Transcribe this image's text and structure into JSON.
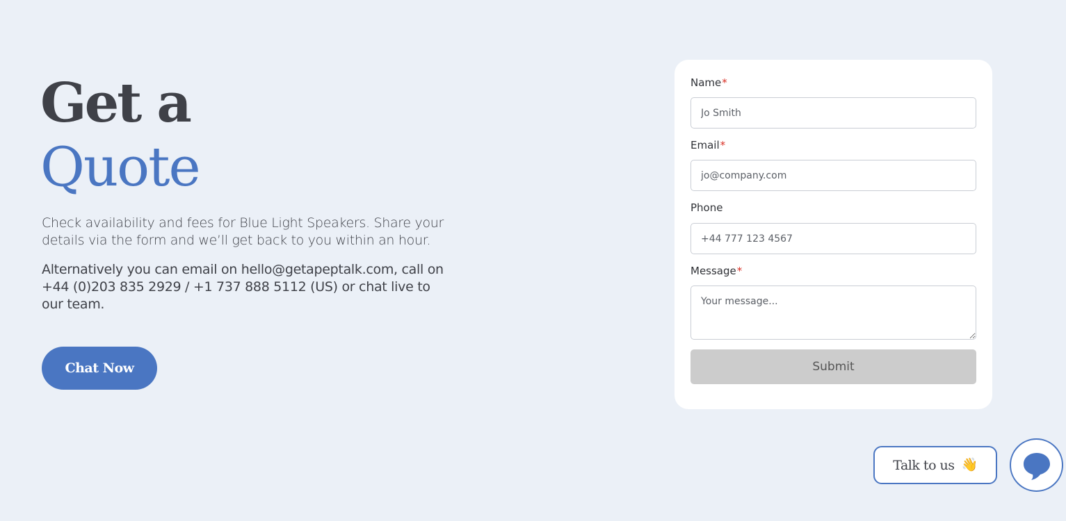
{
  "hero": {
    "title_line1": "Get a",
    "title_line2": "Quote",
    "intro": "Check availability and fees for Blue Light Speakers. Share your details via the form and we’ll get back to you within an hour.",
    "contact": "Alternatively you can email on hello@getapeptalk.com, call on +44 (0)203 835 2929 / +1 737 888 5112 (US) or chat live to our team.",
    "chat_button": "Chat Now"
  },
  "form": {
    "required_mark": "*",
    "name": {
      "label": "Name",
      "placeholder": "Jo Smith",
      "required": true
    },
    "email": {
      "label": "Email",
      "placeholder": "jo@company.com",
      "required": true
    },
    "phone": {
      "label": "Phone",
      "placeholder": "+44 777 123 4567",
      "required": false
    },
    "message": {
      "label": "Message",
      "placeholder": "Your message...",
      "required": true
    },
    "submit_label": "Submit"
  },
  "widget": {
    "talk_label": "Talk to us",
    "talk_emoji": "👋",
    "chat_icon": "chat-bubble-icon"
  },
  "colors": {
    "background": "#ebf0f7",
    "accent": "#4a76c2",
    "heading": "#3f4148",
    "required": "#d93025",
    "submit_disabled": "#cccccc"
  }
}
